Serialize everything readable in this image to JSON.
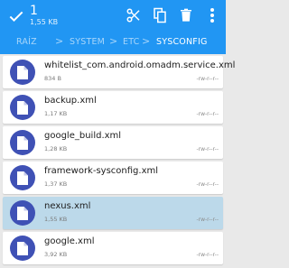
{
  "app_bar": {
    "selected_count": "1",
    "selected_size": "1,55 KB",
    "icons": [
      "check-icon",
      "cut-icon",
      "copy-icon",
      "delete-icon",
      "more-vert-icon"
    ],
    "color": "#2196f3"
  },
  "breadcrumbs": {
    "items": [
      "RAÍZ",
      "SYSTEM",
      "ETC",
      "SYSCONFIG"
    ],
    "separator": ">"
  },
  "files": [
    {
      "name": "whitelist_com.android.omadm.service.xml",
      "size": "834 B",
      "perm": "-rw-r--r--",
      "selected": false
    },
    {
      "name": "backup.xml",
      "size": "1,17 KB",
      "perm": "-rw-r--r--",
      "selected": false
    },
    {
      "name": "google_build.xml",
      "size": "1,28 KB",
      "perm": "-rw-r--r--",
      "selected": false
    },
    {
      "name": "framework-sysconfig.xml",
      "size": "1,37 KB",
      "perm": "-rw-r--r--",
      "selected": false
    },
    {
      "name": "nexus.xml",
      "size": "1,55 KB",
      "perm": "-rw-r--r--",
      "selected": true
    },
    {
      "name": "google.xml",
      "size": "3,92 KB",
      "perm": "-rw-r--r--",
      "selected": false
    }
  ],
  "colors": {
    "file_avatar": "#3f51b5",
    "selected_row": "#bcd9ea"
  }
}
